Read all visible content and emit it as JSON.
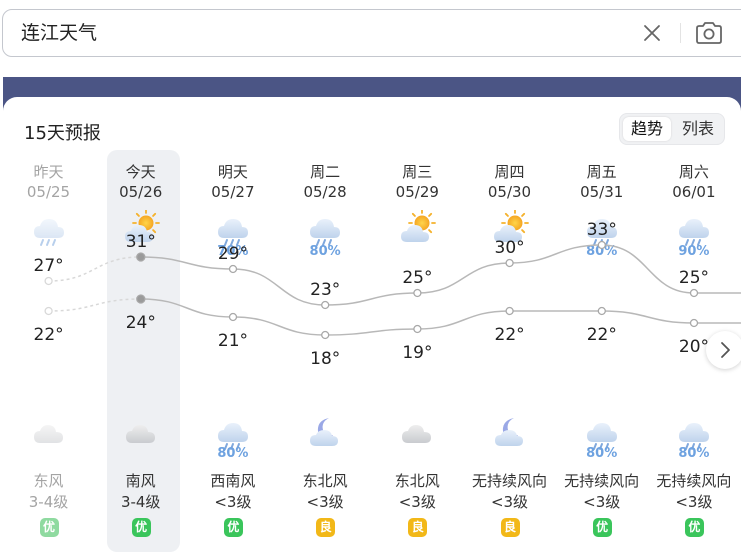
{
  "search": {
    "query": "连江天气"
  },
  "forecast": {
    "title": "15天预报",
    "view_toggle": {
      "options": [
        "趋势",
        "列表"
      ],
      "active": 0
    },
    "days": [
      {
        "name": "昨天",
        "date": "05/25",
        "past": true,
        "icon_day": "cloud-rain-icon",
        "rain_day": "",
        "high": 27,
        "low": 22,
        "icon_night": "cloudy-icon",
        "rain_night": "",
        "wind_dir": "东风",
        "wind_level": "3-4级",
        "aqi": "优",
        "aqi_level": "good"
      },
      {
        "name": "今天",
        "date": "05/26",
        "past": false,
        "today": true,
        "icon_day": "partly-sunny-icon",
        "rain_day": "",
        "high": 31,
        "low": 24,
        "icon_night": "cloudy-icon",
        "rain_night": "",
        "wind_dir": "南风",
        "wind_level": "3-4级",
        "aqi": "优",
        "aqi_level": "good"
      },
      {
        "name": "明天",
        "date": "05/27",
        "past": false,
        "icon_day": "cloud-rain-icon",
        "rain_day": "70%",
        "high": 29,
        "low": 21,
        "icon_night": "cloud-rain-icon",
        "rain_night": "80%",
        "wind_dir": "西南风",
        "wind_level": "<3级",
        "aqi": "优",
        "aqi_level": "good"
      },
      {
        "name": "周二",
        "date": "05/28",
        "past": false,
        "icon_day": "cloud-rain-icon",
        "rain_day": "80%",
        "high": 23,
        "low": 18,
        "icon_night": "moon-cloud-icon",
        "rain_night": "",
        "wind_dir": "东北风",
        "wind_level": "<3级",
        "aqi": "良",
        "aqi_level": "mod"
      },
      {
        "name": "周三",
        "date": "05/29",
        "past": false,
        "icon_day": "partly-sunny-icon",
        "rain_day": "",
        "high": 25,
        "low": 19,
        "icon_night": "cloudy-icon",
        "rain_night": "",
        "wind_dir": "东北风",
        "wind_level": "<3级",
        "aqi": "良",
        "aqi_level": "mod"
      },
      {
        "name": "周四",
        "date": "05/30",
        "past": false,
        "icon_day": "partly-sunny-icon",
        "rain_day": "",
        "high": 30,
        "low": 22,
        "icon_night": "moon-cloud-icon",
        "rain_night": "",
        "wind_dir": "无持续风向",
        "wind_level": "<3级",
        "aqi": "良",
        "aqi_level": "mod"
      },
      {
        "name": "周五",
        "date": "05/31",
        "past": false,
        "icon_day": "cloud-rain-icon",
        "rain_day": "80%",
        "high": 33,
        "low": 22,
        "icon_night": "cloud-rain-icon",
        "rain_night": "80%",
        "wind_dir": "无持续风向",
        "wind_level": "<3级",
        "aqi": "优",
        "aqi_level": "good"
      },
      {
        "name": "周六",
        "date": "06/01",
        "past": false,
        "icon_day": "cloud-rain-icon",
        "rain_day": "90%",
        "high": 25,
        "low": 20,
        "icon_night": "cloud-rain-icon",
        "rain_night": "80%",
        "wind_dir": "无持续风向",
        "wind_level": "<3级",
        "aqi": "优",
        "aqi_level": "good"
      }
    ]
  },
  "colors": {
    "banner": "#4b5585",
    "rain_text": "#6ea2e0",
    "aqi_good": "#3ac55b",
    "aqi_moderate": "#f2b818",
    "curve": "#b8b8b8"
  }
}
